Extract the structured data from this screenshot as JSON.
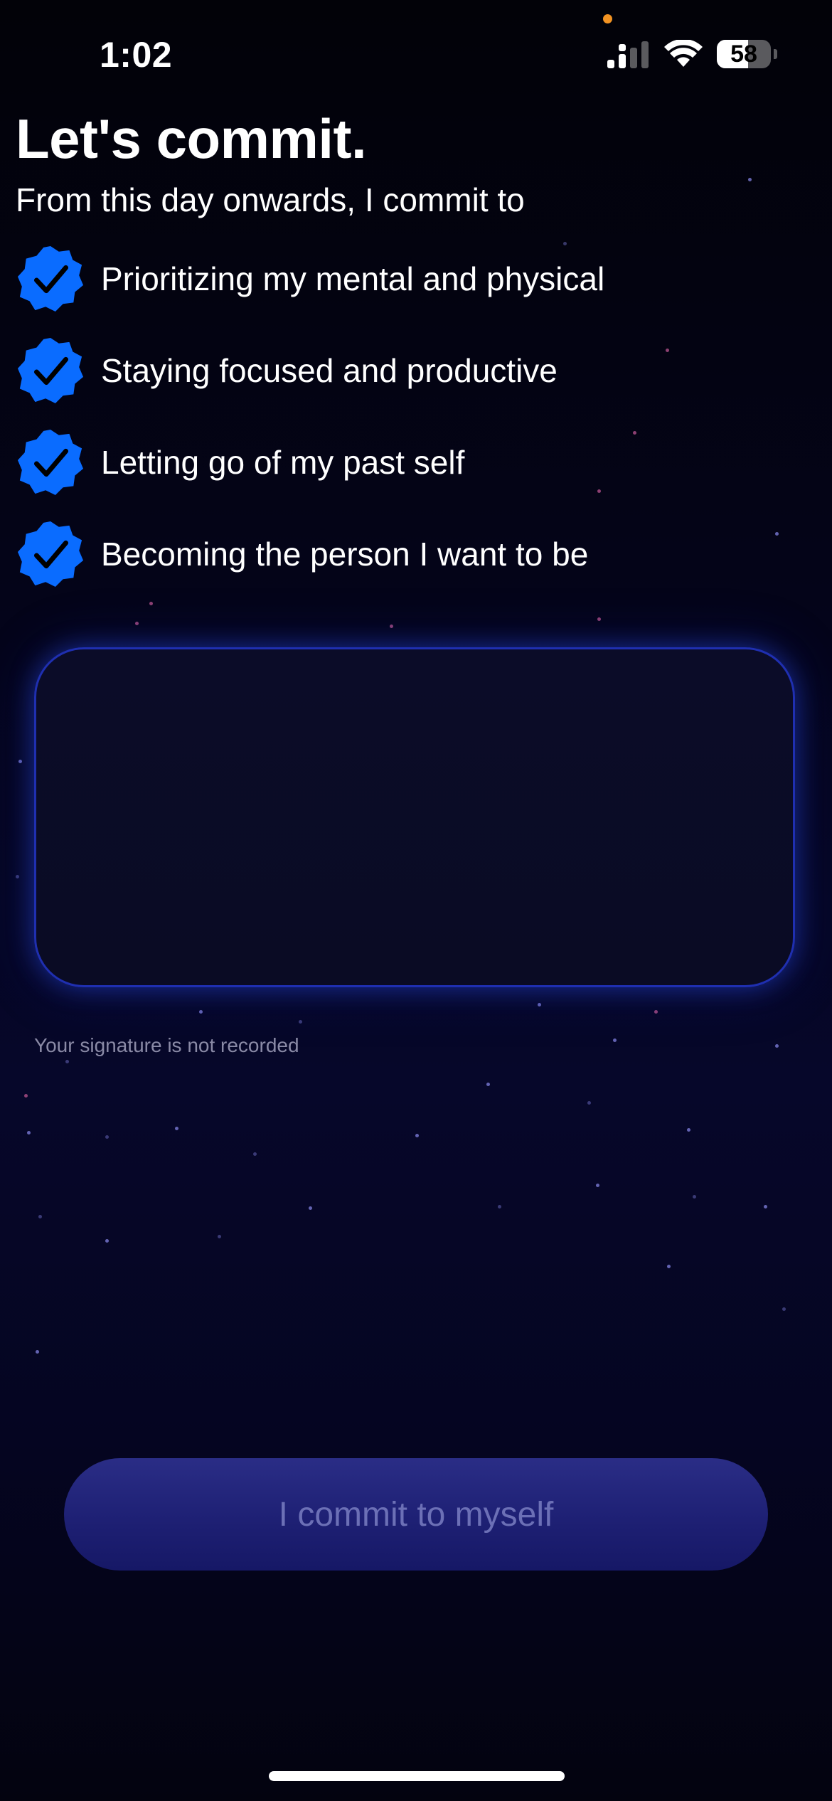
{
  "status_bar": {
    "time": "1:02",
    "battery_level": "58",
    "battery_fraction": 0.58,
    "signal_icon": "cellular-signal-icon",
    "wifi_icon": "wifi-icon",
    "privacy_indicator_color": "#f29322"
  },
  "header": {
    "title": "Let's commit.",
    "subtitle": "From this day onwards, I commit to"
  },
  "commitments": [
    {
      "label": "Prioritizing my mental and physical",
      "checked": true
    },
    {
      "label": "Staying focused and productive",
      "checked": true
    },
    {
      "label": "Letting go of my past self",
      "checked": true
    },
    {
      "label": "Becoming the person I want to be",
      "checked": true
    }
  ],
  "signature": {
    "note": "Your signature is not recorded"
  },
  "commit_button": {
    "label": "I commit to myself"
  },
  "colors": {
    "accent": "#0a6cff",
    "signature_border": "#1f2fb0",
    "button": "#1e2074"
  },
  "icons": {
    "check": "verified-check-badge-icon"
  }
}
